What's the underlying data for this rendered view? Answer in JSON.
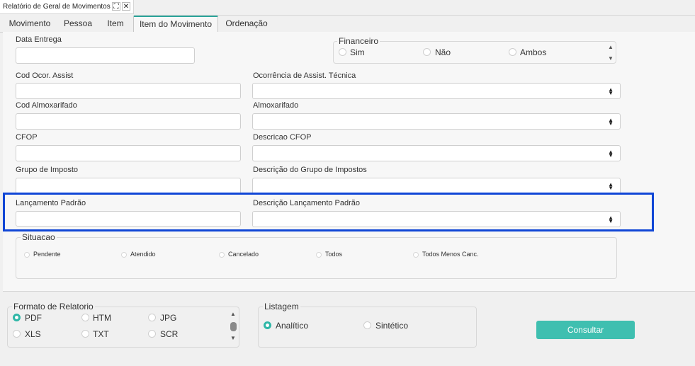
{
  "window": {
    "title": "Relatório de Geral de Movimentos",
    "expand_icon": "expand-icon",
    "close_icon": "close-icon",
    "close_glyph": "✕",
    "expand_glyph": "⛶"
  },
  "tabs": [
    {
      "label": "Movimento"
    },
    {
      "label": "Pessoa"
    },
    {
      "label": "Item"
    },
    {
      "label": "Item do Movimento",
      "active": true
    },
    {
      "label": "Ordenação"
    }
  ],
  "form": {
    "data_entrega": {
      "label": "Data Entrega",
      "value": ""
    },
    "financeiro": {
      "legend": "Financeiro",
      "options": [
        "Sim",
        "Não",
        "Ambos"
      ],
      "selected": null
    },
    "cod_ocor": {
      "label": "Cod Ocor. Assist",
      "value": ""
    },
    "ocorrencia": {
      "label": "Ocorrência de Assist. Técnica",
      "value": ""
    },
    "cod_almox": {
      "label": "Cod Almoxarifado",
      "value": ""
    },
    "almox": {
      "label": "Almoxarifado",
      "value": ""
    },
    "cfop": {
      "label": "CFOP",
      "value": ""
    },
    "descricao_cfop": {
      "label": "Descricao CFOP",
      "value": ""
    },
    "grupo_imposto": {
      "label": "Grupo de Imposto",
      "value": ""
    },
    "desc_grupo_impostos": {
      "label": "Descrição do Grupo de Impostos",
      "value": ""
    },
    "lancamento_padrao": {
      "label": "Lançamento Padrão",
      "value": ""
    },
    "desc_lancamento_padrao": {
      "label": "Descrição Lançamento Padrão",
      "value": ""
    },
    "situacao": {
      "legend": "Situacao",
      "options": [
        "Pendente",
        "Atendido",
        "Cancelado",
        "Todos",
        "Todos Menos Canc."
      ],
      "selected": null
    }
  },
  "formato": {
    "legend": "Formato de Relatorio",
    "options": [
      "PDF",
      "HTM",
      "JPG",
      "XLS",
      "TXT",
      "SCR"
    ],
    "selected": "PDF"
  },
  "listagem": {
    "legend": "Listagem",
    "options": [
      "Analítico",
      "Sintético"
    ],
    "selected": "Analítico"
  },
  "actions": {
    "consultar": "Consultar"
  },
  "colors": {
    "accent": "#3fbfb0",
    "highlight": "#1046d6"
  },
  "glyphs": {
    "sel_up": "▲",
    "sel_down": "▼"
  }
}
